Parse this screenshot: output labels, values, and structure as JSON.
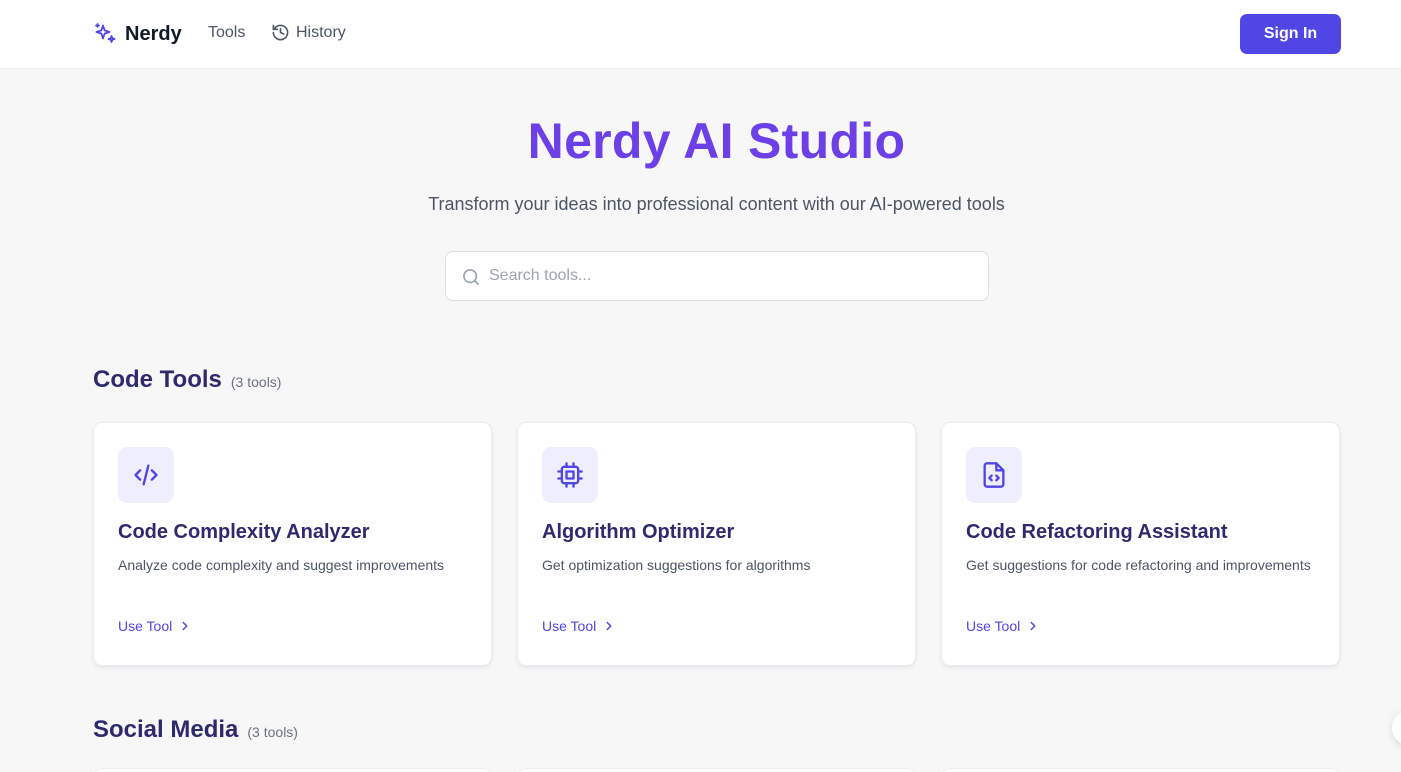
{
  "header": {
    "brand": "Nerdy",
    "nav_tools": "Tools",
    "nav_history": "History",
    "sign_in": "Sign In"
  },
  "hero": {
    "title": "Nerdy AI Studio",
    "subtitle": "Transform your ideas into professional content with our AI-powered tools",
    "search_placeholder": "Search tools...",
    "search_value": ""
  },
  "sections": [
    {
      "title": "Code Tools",
      "count": "(3 tools)",
      "cards": [
        {
          "icon": "code-icon",
          "title": "Code Complexity Analyzer",
          "description": "Analyze code complexity and suggest improvements",
          "action": "Use Tool"
        },
        {
          "icon": "cpu-icon",
          "title": "Algorithm Optimizer",
          "description": "Get optimization suggestions for algorithms",
          "action": "Use Tool"
        },
        {
          "icon": "file-code-icon",
          "title": "Code Refactoring Assistant",
          "description": "Get suggestions for code refactoring and improvements",
          "action": "Use Tool"
        }
      ]
    },
    {
      "title": "Social Media",
      "count": "(3 tools)"
    }
  ],
  "colors": {
    "accent": "#4f46e5",
    "hero_title": "#6d3fe6",
    "heading": "#2e2a6e",
    "background": "#f8f7f8",
    "icon_box": "#eeeefd"
  }
}
